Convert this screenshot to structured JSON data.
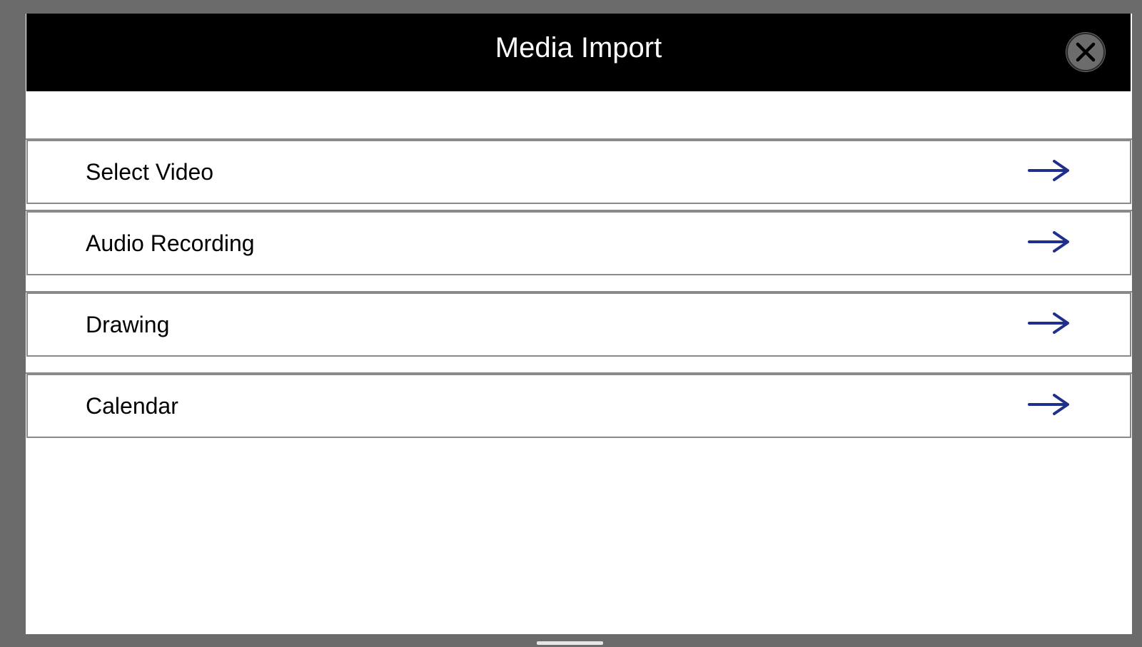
{
  "dialog": {
    "title": "Media Import",
    "close_icon": "close-icon",
    "items": [
      {
        "label": "Select Video",
        "icon": "arrow-right-icon"
      },
      {
        "label": "Audio Recording",
        "icon": "arrow-right-icon"
      },
      {
        "label": "Drawing",
        "icon": "arrow-right-icon"
      },
      {
        "label": "Calendar",
        "icon": "arrow-right-icon"
      }
    ]
  },
  "colors": {
    "header_background": "#000000",
    "accent_arrow": "#1f2f8a",
    "backdrop": "#6b6b6b"
  }
}
